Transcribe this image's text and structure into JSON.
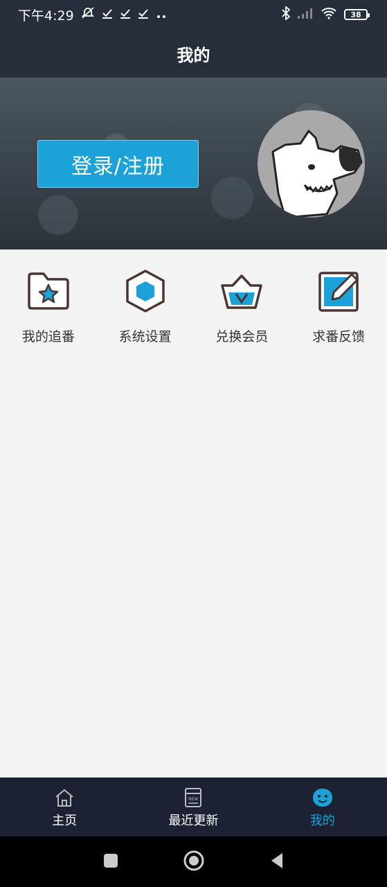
{
  "status_bar": {
    "time_text": "下午4:29",
    "battery_level": "38"
  },
  "header": {
    "title": "我的"
  },
  "banner": {
    "login_label": "登录/注册"
  },
  "menu": [
    {
      "label": "我的追番",
      "icon": "folder-star-icon"
    },
    {
      "label": "系统设置",
      "icon": "hexagon-settings-icon"
    },
    {
      "label": "兑换会员",
      "icon": "crown-vip-icon"
    },
    {
      "label": "求番反馈",
      "icon": "edit-feedback-icon"
    }
  ],
  "bottom_nav": [
    {
      "label": "主页",
      "icon": "home-icon",
      "active": false
    },
    {
      "label": "最近更新",
      "icon": "new-list-icon",
      "active": false
    },
    {
      "label": "我的",
      "icon": "profile-face-icon",
      "active": true
    }
  ],
  "colors": {
    "accent": "#1da2d8",
    "header_bg": "#262d3b",
    "nav_bg": "#1c2233",
    "page_bg": "#f3f3f3"
  }
}
